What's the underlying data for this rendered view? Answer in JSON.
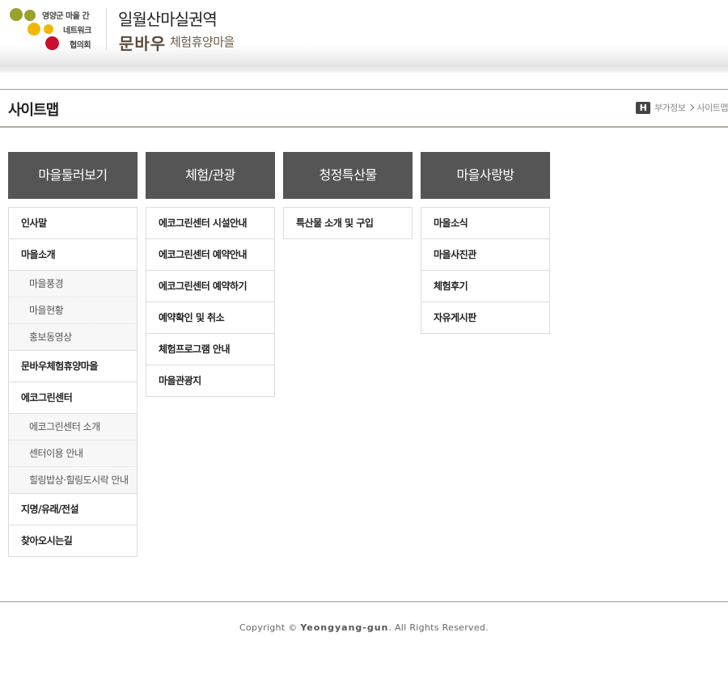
{
  "header": {
    "logo": {
      "lines": [
        "영양군 마을 간",
        "네트워크",
        "협의회"
      ],
      "colors": {
        "olive": "#9aa02b",
        "yellow": "#f2b705",
        "red": "#c8102e"
      }
    },
    "village_area": "일월산마실권역",
    "village_brand": "문바우",
    "village_sub": "체험휴양마을"
  },
  "title_bar": {
    "title": "사이트맵",
    "breadcrumb": {
      "home_glyph": "H",
      "items": [
        "부가정보",
        "사이트맵"
      ]
    }
  },
  "sitemap": {
    "columns": [
      {
        "title": "마을둘러보기",
        "items": [
          {
            "label": "인사말",
            "subitems": []
          },
          {
            "label": "마을소개",
            "subitems": [
              "마을풍경",
              "마을현황",
              "홍보동영상"
            ]
          },
          {
            "label": "문바우체험휴양마을",
            "subitems": []
          },
          {
            "label": "에코그린센터",
            "subitems": [
              "에코그린센터 소개",
              "센터이용 안내",
              "힐링밥상·힐링도시락 안내"
            ]
          },
          {
            "label": "지명/유래/전설",
            "subitems": []
          },
          {
            "label": "찾아오시는길",
            "subitems": []
          }
        ]
      },
      {
        "title": "체험/관광",
        "items": [
          {
            "label": "에코그린센터 시설안내",
            "subitems": []
          },
          {
            "label": "에코그린센터 예약안내",
            "subitems": []
          },
          {
            "label": "에코그린센터 예약하기",
            "subitems": []
          },
          {
            "label": "예약확인 및 취소",
            "subitems": []
          },
          {
            "label": "체험프로그램 안내",
            "subitems": []
          },
          {
            "label": "마을관광지",
            "subitems": []
          }
        ]
      },
      {
        "title": "청정특산물",
        "items": [
          {
            "label": "특산물 소개 및 구입",
            "subitems": []
          }
        ]
      },
      {
        "title": "마을사랑방",
        "items": [
          {
            "label": "마을소식",
            "subitems": []
          },
          {
            "label": "마을사진관",
            "subitems": []
          },
          {
            "label": "체험후기",
            "subitems": []
          },
          {
            "label": "자유게시판",
            "subitems": []
          }
        ]
      }
    ]
  },
  "footer": {
    "prefix": "Copyright © ",
    "brand": "Yeongyang-gun",
    "suffix": ". All Rights Reserved."
  }
}
